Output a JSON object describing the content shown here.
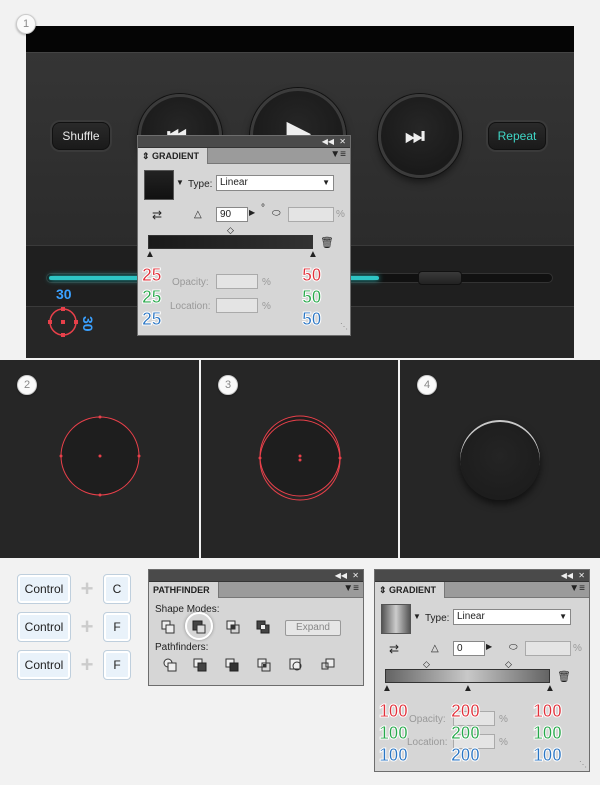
{
  "steps": [
    "1",
    "2",
    "3",
    "4"
  ],
  "player": {
    "shuffle_label": "Shuffle",
    "repeat_label": "Repeat",
    "dimension_w": "30",
    "dimension_h": "30",
    "accent": "#2ec4c4"
  },
  "gradient_panel_1": {
    "tab": "GRADIENT",
    "type_label": "Type:",
    "type_value": "Linear",
    "angle_value": "90",
    "degree_symbol": "°",
    "percent_symbol": "%",
    "opacity_label": "Opacity:",
    "location_label": "Location:",
    "left_stop": {
      "r": "25",
      "g": "25",
      "b": "25"
    },
    "right_stop": {
      "r": "50",
      "g": "50",
      "b": "50"
    }
  },
  "shortcuts": [
    {
      "mod": "Control",
      "key": "C"
    },
    {
      "mod": "Control",
      "key": "F"
    },
    {
      "mod": "Control",
      "key": "F"
    }
  ],
  "pathfinder": {
    "tab": "PATHFINDER",
    "shape_modes_label": "Shape Modes:",
    "pathfinders_label": "Pathfinders:",
    "expand_label": "Expand"
  },
  "gradient_panel_2": {
    "tab": "GRADIENT",
    "type_label": "Type:",
    "type_value": "Linear",
    "angle_value": "0",
    "percent_symbol": "%",
    "opacity_label": "Opacity:",
    "location_label": "Location:",
    "left_stop": {
      "r": "100",
      "g": "100",
      "b": "100"
    },
    "mid_stop": {
      "r": "200",
      "g": "200",
      "b": "200"
    },
    "right_stop": {
      "r": "100",
      "g": "100",
      "b": "100"
    }
  },
  "colors": {
    "red": "#e1303a",
    "green": "#26a84a",
    "blue": "#2a76c4",
    "guide_red": "#e8404a"
  }
}
